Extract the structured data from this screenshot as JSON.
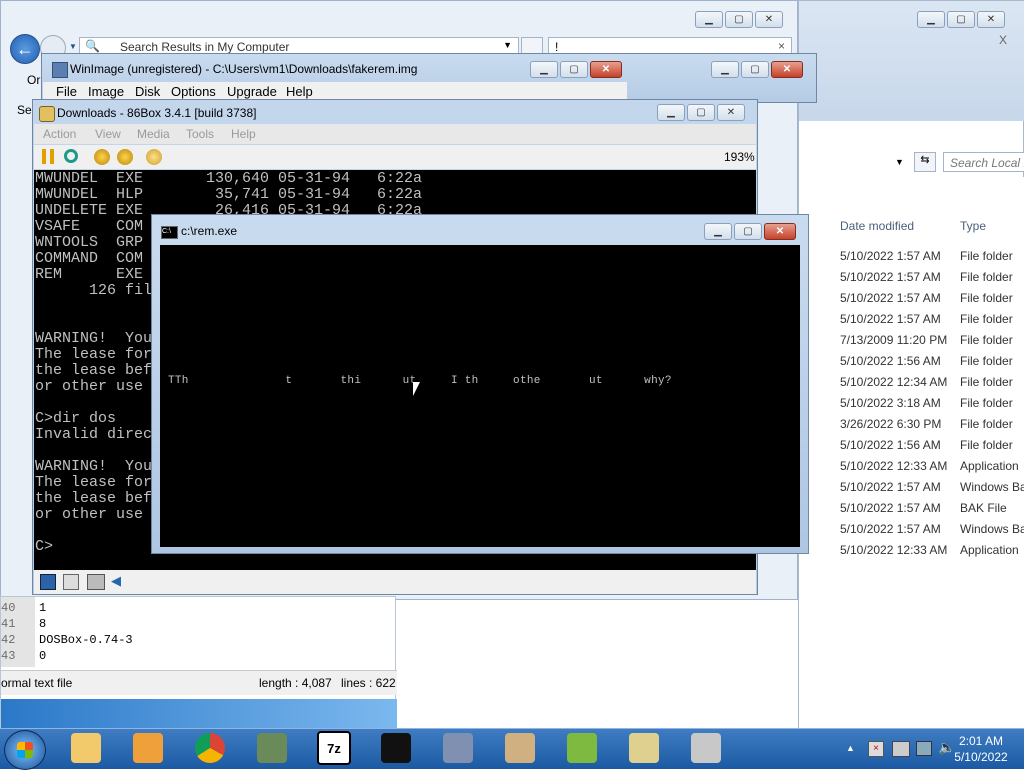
{
  "explorer_back": {
    "search_path": "Search Results in My Computer",
    "address_text": "!",
    "or_label": "Or",
    "sea_label": "Sea"
  },
  "explorer_right": {
    "search_placeholder": "Search Local D",
    "columns": {
      "date_modified": "Date modified",
      "type": "Type"
    },
    "rows": [
      {
        "date": "5/10/2022 1:57 AM",
        "type": "File folder"
      },
      {
        "date": "5/10/2022 1:57 AM",
        "type": "File folder"
      },
      {
        "date": "5/10/2022 1:57 AM",
        "type": "File folder"
      },
      {
        "date": "5/10/2022 1:57 AM",
        "type": "File folder"
      },
      {
        "date": "7/13/2009 11:20 PM",
        "type": "File folder"
      },
      {
        "date": "5/10/2022 1:56 AM",
        "type": "File folder"
      },
      {
        "date": "5/10/2022 12:34 AM",
        "type": "File folder"
      },
      {
        "date": "5/10/2022 3:18 AM",
        "type": "File folder"
      },
      {
        "date": "3/26/2022 6:30 PM",
        "type": "File folder"
      },
      {
        "date": "5/10/2022 1:56 AM",
        "type": "File folder"
      },
      {
        "date": "5/10/2022 12:33 AM",
        "type": "Application"
      },
      {
        "date": "5/10/2022 1:57 AM",
        "type": "Windows Ba"
      },
      {
        "date": "5/10/2022 1:57 AM",
        "type": "BAK File"
      },
      {
        "date": "5/10/2022 1:57 AM",
        "type": "Windows Ba"
      },
      {
        "date": "5/10/2022 12:33 AM",
        "type": "Application"
      }
    ]
  },
  "winimage": {
    "title": "WinImage (unregistered) - C:\\Users\\vm1\\Downloads\\fakerem.img",
    "menu": [
      "File",
      "Image",
      "Disk",
      "Options",
      "Upgrade",
      "Help"
    ]
  },
  "box86": {
    "title": "Downloads - 86Box 3.4.1 [build 3738]",
    "menu": [
      "Action",
      "View",
      "Media",
      "Tools",
      "Help"
    ],
    "zoom": "193%",
    "dos_lines": [
      "MWUNDEL  EXE       130,640 05-31-94   6:22a",
      "MWUNDEL  HLP        35,741 05-31-94   6:22a",
      "UNDELETE EXE        26,416 05-31-94   6:22a",
      "VSAFE    COM",
      "WNTOOLS  GRP",
      "COMMAND  COM",
      "REM      EXE",
      "      126 fil",
      "",
      "",
      "WARNING!  You",
      "The lease for",
      "the lease bef",
      "or other use",
      "",
      "C>dir dos",
      "Invalid direc",
      "",
      "WARNING!  You",
      "The lease for",
      "the lease bef",
      "or other use",
      "",
      "C>"
    ]
  },
  "rem": {
    "title": "c:\\rem.exe",
    "garbled_line": "TTh              t       thi      ut     I th     othe       ut      why?"
  },
  "notepad": {
    "line_numbers": [
      "40",
      "41",
      "42",
      "43"
    ],
    "lines": [
      "1",
      "8",
      "DOSBox-0.74-3",
      "0"
    ],
    "status_type": "ormal text file",
    "status_length": "length : 4,087",
    "status_lines": "lines : 622"
  },
  "taskbar": {
    "time": "2:01 AM",
    "date": "5/10/2022",
    "apps": [
      "explorer",
      "media-player",
      "chrome",
      "86box",
      "7-zip",
      "cmd",
      "winimage",
      "paint",
      "notepad-plus",
      "disc",
      "disc-burn"
    ],
    "seven_zip_label": "7z"
  },
  "colors": {
    "taskbar": "#1b5aa3",
    "dos_bg": "#000000",
    "dos_text": "#c0c0c0",
    "close_red": "#c4412b"
  }
}
